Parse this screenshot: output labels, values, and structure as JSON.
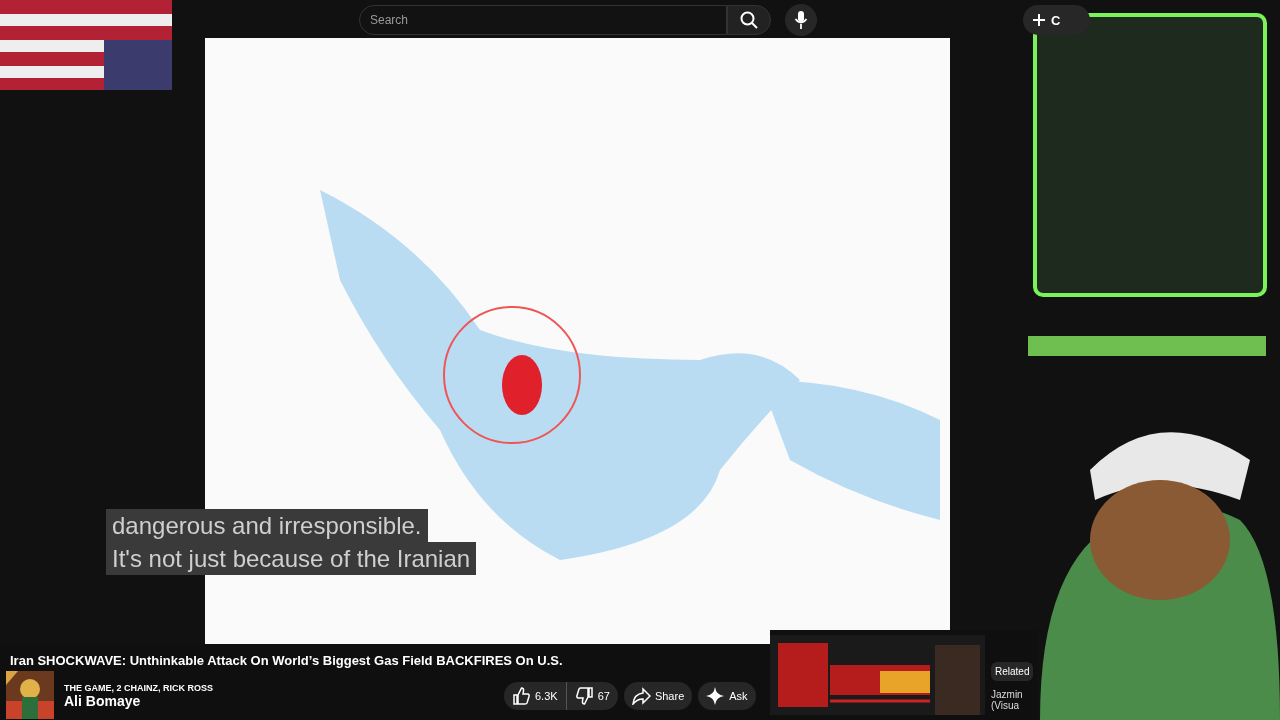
{
  "topbar": {
    "search": {
      "placeholder": "Search"
    },
    "create_button": {
      "label": "C"
    }
  },
  "captions": [
    "dangerous and irresponsible.",
    "It's not just because of the Iranian"
  ],
  "details": {
    "title": "Iran SHOCKWAVE: Unthinkable Attack On World’s Biggest Gas Field BACKFIRES On U.S.",
    "channel": {
      "subtitle": "THE GAME, 2 CHAINZ, RICK ROSS",
      "name": "Ali Bomaye"
    },
    "actions": [
      {
        "kind": "like",
        "label": "6.3K"
      },
      {
        "kind": "dislike",
        "label": "67"
      },
      {
        "kind": "share",
        "label": "Share"
      },
      {
        "kind": "ask",
        "label": "Ask"
      }
    ]
  },
  "related": {
    "chip": "Related",
    "item": {
      "kind": "picture",
      "author": [
        "Jazmin",
        "(Visua"
      ]
    }
  }
}
